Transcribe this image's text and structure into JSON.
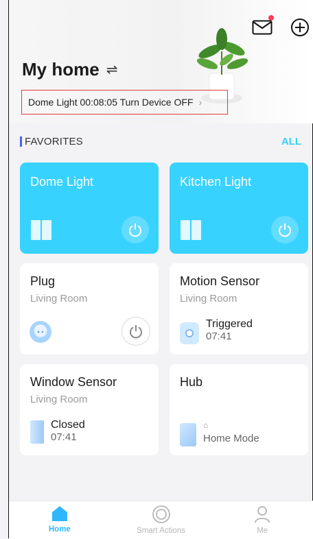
{
  "header": {
    "title": "My home",
    "switch_glyph": "⇌",
    "notice": "Dome Light 00:08:05 Turn Device OFF",
    "notice_chevron": "›",
    "mail_has_unread": true,
    "icons": [
      "mail-icon",
      "add-circle-icon",
      "swap-arrows-icon"
    ]
  },
  "favorites": {
    "label": "FAVORITES",
    "all_label": "ALL"
  },
  "devices": [
    {
      "name": "Dome Light",
      "room": "",
      "on": true
    },
    {
      "name": "Kitchen Light",
      "room": "",
      "on": true
    },
    {
      "name": "Plug",
      "room": "Living Room",
      "on": false
    },
    {
      "name": "Motion Sensor",
      "room": "Living Room",
      "status": "Triggered",
      "time": "07:41"
    },
    {
      "name": "Window Sensor",
      "room": "Living Room",
      "status": "Closed",
      "time": "07:41"
    },
    {
      "name": "Hub",
      "room": "",
      "status": "Home Mode"
    }
  ],
  "tabs": [
    {
      "label": "Home",
      "active": true,
      "icon": "home-icon"
    },
    {
      "label": "Smart Actions",
      "active": false,
      "icon": "smart-actions-icon"
    },
    {
      "label": "Me",
      "active": false,
      "icon": "user-icon"
    }
  ],
  "colors": {
    "accent": "#38d2ff",
    "link": "#3ad0f5",
    "active_tab": "#2fb6ff",
    "favorites_bar": "#4a63f0",
    "notice_border": "#e03b3b",
    "badge": "#ff3b55"
  }
}
